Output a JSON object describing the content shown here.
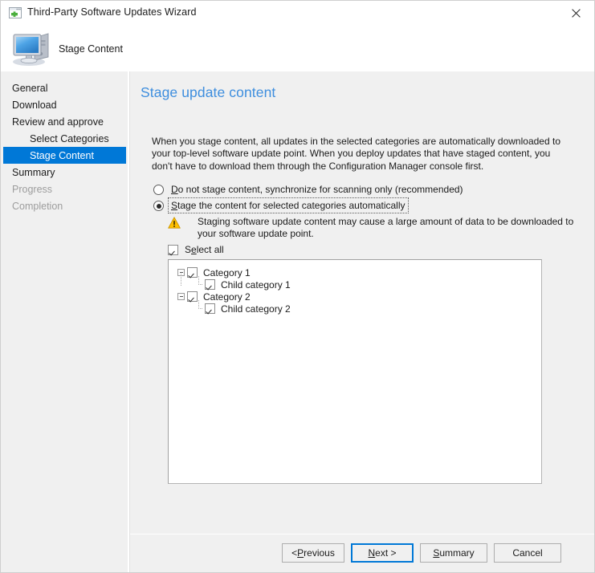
{
  "window": {
    "title": "Third-Party Software Updates Wizard",
    "title_icon": "wizard-window-add-icon",
    "close_icon": "close-icon",
    "banner_title": "Stage Content",
    "banner_icon": "computer-icon"
  },
  "sidebar": {
    "items": [
      {
        "label": "General",
        "indent": false,
        "selected": false,
        "disabled": false
      },
      {
        "label": "Download",
        "indent": false,
        "selected": false,
        "disabled": false
      },
      {
        "label": "Review and approve",
        "indent": false,
        "selected": false,
        "disabled": false
      },
      {
        "label": "Select Categories",
        "indent": true,
        "selected": false,
        "disabled": false
      },
      {
        "label": "Stage Content",
        "indent": true,
        "selected": true,
        "disabled": false
      },
      {
        "label": "Summary",
        "indent": false,
        "selected": false,
        "disabled": false
      },
      {
        "label": "Progress",
        "indent": false,
        "selected": false,
        "disabled": true
      },
      {
        "label": "Completion",
        "indent": false,
        "selected": false,
        "disabled": true
      }
    ]
  },
  "main": {
    "heading": "Stage update content",
    "intro": "When you stage content, all updates in the selected categories are automatically downloaded to your top-level software update point. When you deploy updates that have staged content, you don't have to download them through the Configuration Manager console first.",
    "options": [
      {
        "id": "do-not-stage",
        "accelerator": "D",
        "rest": "o not stage content, synchronize for scanning only (recommended)",
        "selected": false,
        "focused": false
      },
      {
        "id": "stage-automatically",
        "accelerator": "S",
        "rest": "tage the content for selected categories automatically",
        "selected": true,
        "focused": true
      }
    ],
    "warning": {
      "icon": "warning-triangle-icon",
      "text": "Staging software update content may cause a large amount of data to be downloaded to your software update point."
    },
    "select_all": {
      "accelerator_prefix": "S",
      "accelerator": "e",
      "rest": "lect all",
      "checked": true
    },
    "tree": [
      {
        "label": "Category 1",
        "level": 0,
        "checked": true,
        "expanded": true,
        "last": false
      },
      {
        "label": "Child category 1",
        "level": 1,
        "checked": true,
        "expanded": null,
        "last": true
      },
      {
        "label": "Category 2",
        "level": 0,
        "checked": true,
        "expanded": true,
        "last": true
      },
      {
        "label": "Child category 2",
        "level": 1,
        "checked": true,
        "expanded": null,
        "last": true
      }
    ]
  },
  "footer": {
    "previous": {
      "pre": "< ",
      "accelerator": "P",
      "post": "revious"
    },
    "next": {
      "pre": "",
      "accelerator": "N",
      "post": "ext >"
    },
    "summary": {
      "pre": "",
      "accelerator": "S",
      "post": "ummary"
    },
    "cancel": {
      "pre": "",
      "accelerator": "",
      "post": "Cancel"
    }
  },
  "colors": {
    "accent": "#0078d7",
    "heading": "#3e8ede",
    "chrome": "#f0f0f0",
    "warning": "#ffc000"
  }
}
